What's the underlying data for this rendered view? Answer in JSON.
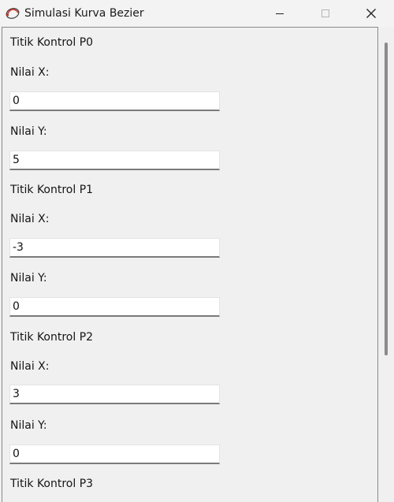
{
  "window": {
    "title": "Simulasi Kurva Bezier",
    "controls": [
      "minimize-icon",
      "maximize-icon",
      "close-icon"
    ]
  },
  "form": {
    "p0": {
      "heading": "Titik Kontrol P0",
      "x_label": "Nilai X:",
      "x_value": "0",
      "y_label": "Nilai Y:",
      "y_value": "5"
    },
    "p1": {
      "heading": "Titik Kontrol P1",
      "x_label": "Nilai X:",
      "x_value": "-3",
      "y_label": "Nilai Y:",
      "y_value": "0"
    },
    "p2": {
      "heading": "Titik Kontrol P2",
      "x_label": "Nilai X:",
      "x_value": "3",
      "y_label": "Nilai Y:",
      "y_value": "0"
    },
    "p3": {
      "heading": "Titik Kontrol P3"
    }
  }
}
